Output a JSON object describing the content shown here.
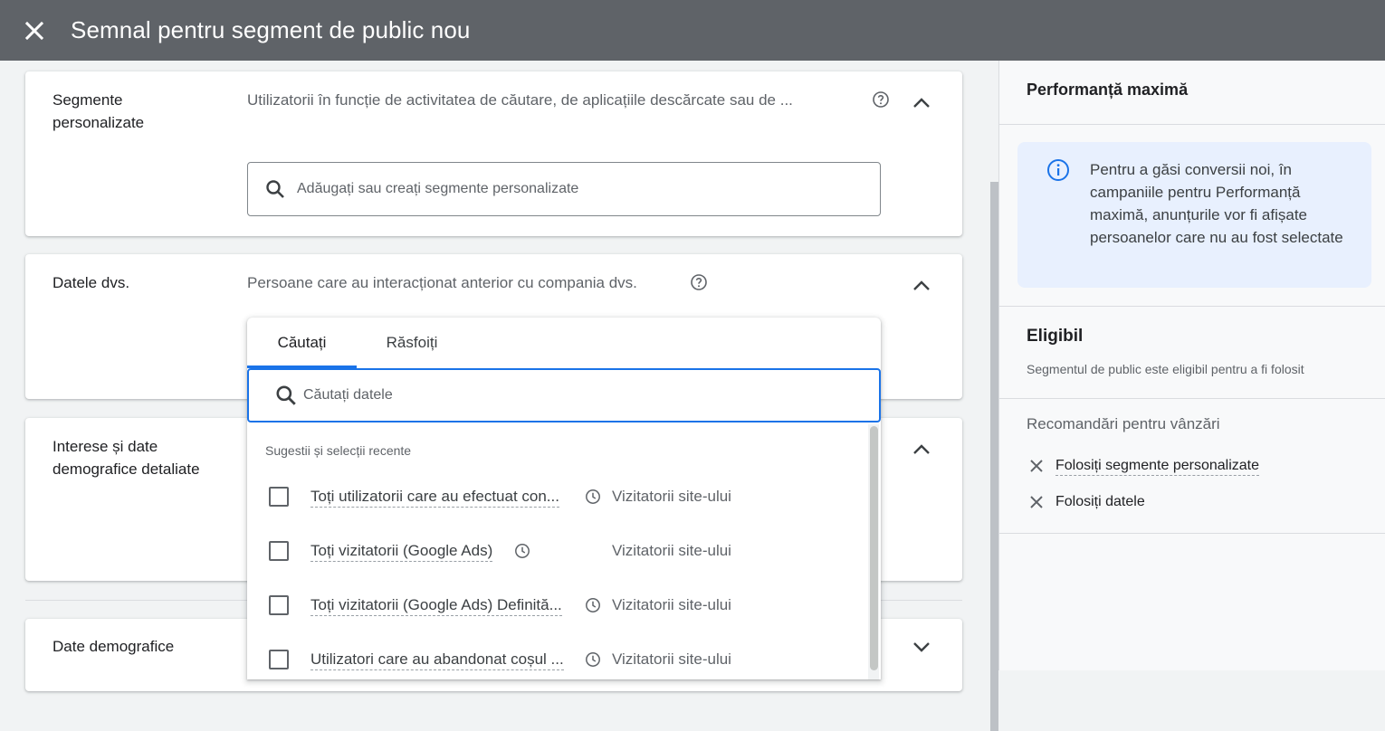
{
  "header": {
    "title": "Semnal pentru segment de public nou"
  },
  "cards": {
    "custom_segments": {
      "title": "Segmente personalizate",
      "description": "Utilizatorii în funcție de activitatea de căutare, de aplicațiile descărcate sau de ...",
      "search_placeholder": "Adăugați sau creați segmente personalizate"
    },
    "your_data": {
      "title": "Datele dvs.",
      "description": "Persoane care au interacționat anterior cu compania dvs."
    },
    "interests": {
      "title": "Interese și date demografice detaliate"
    },
    "demographics": {
      "title": "Date demografice"
    }
  },
  "dropdown": {
    "tabs": [
      {
        "label": "Căutați",
        "active": true
      },
      {
        "label": "Răsfoiți",
        "active": false
      }
    ],
    "search_placeholder": "Căutați datele",
    "section_label": "Sugestii și selecții recente",
    "items": [
      {
        "label": "Toți utilizatorii care au efectuat con...",
        "type": "Vizitatorii site-ului",
        "checked": false
      },
      {
        "label": "Toți vizitatorii (Google Ads)",
        "type": "Vizitatorii site-ului",
        "checked": false
      },
      {
        "label": "Toți vizitatorii (Google Ads) Definită...",
        "type": "Vizitatorii site-ului",
        "checked": false
      },
      {
        "label": "Utilizatori care au abandonat coșul ...",
        "type": "Vizitatorii site-ului",
        "checked": false
      }
    ]
  },
  "side_panel": {
    "heading": "Performanță maximă",
    "info": "Pentru a găsi conversii noi, în campaniile pentru Performanță maximă, anunțurile vor fi afișate persoanelor care nu au fost selectate",
    "eligibility_title": "Eligibil",
    "eligibility_desc": "Segmentul de public este eligibil pentru a fi folosit",
    "recommendations_title": "Recomandări pentru vânzări",
    "recommendations": [
      "Folosiți segmente personalizate",
      "Folosiți datele"
    ]
  },
  "colors": {
    "header_bg": "#5f6368",
    "accent": "#1a73e8",
    "info_bg": "#e8f0fe"
  }
}
